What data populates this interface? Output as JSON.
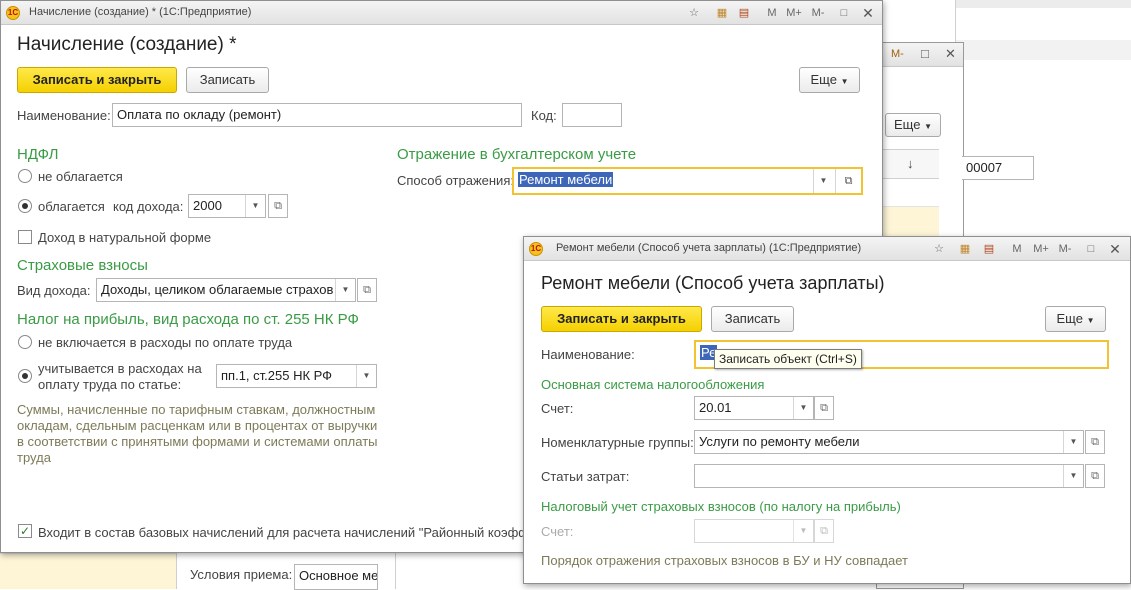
{
  "background_window": {
    "titlebar_buttons": [
      "M-",
      "□",
      "✕"
    ],
    "more_label": "Еще",
    "sort_arrow": "↓",
    "number_value": "00007",
    "conditions_label": "Условия приема:",
    "conditions_value": "Основное ме"
  },
  "main_window": {
    "title": "Начисление (создание) * (1С:Предприятие)",
    "titlebar_buttons": [
      "M",
      "M+",
      "M-",
      "□",
      "✕"
    ],
    "form_title": "Начисление (создание) *",
    "save_close_label": "Записать и закрыть",
    "save_label": "Записать",
    "more_label": "Еще",
    "name_label": "Наименование:",
    "name_value": "Оплата по окладу (ремонт)",
    "code_label": "Код:",
    "code_value": "",
    "ndfl": {
      "heading": "НДФЛ",
      "not_taxed_label": "не облагается",
      "taxed_label": "облагается",
      "income_code_label": "код дохода:",
      "income_code_value": "2000",
      "natural_income_label": "Доход в натуральной форме"
    },
    "accounting": {
      "heading": "Отражение в бухгалтерском учете",
      "method_label": "Способ отражения:",
      "method_value": "Ремонт мебели"
    },
    "insurance": {
      "heading": "Страховые взносы",
      "income_type_label": "Вид дохода:",
      "income_type_value": "Доходы, целиком облагаемые страхов"
    },
    "profit_tax": {
      "heading": "Налог на прибыль, вид расхода по ст. 255 НК РФ",
      "not_included_label": "не включается в расходы по оплате труда",
      "included_label_line1": "учитывается в расходах на",
      "included_label_line2": "оплату труда по статье:",
      "article_value": "пп.1, ст.255 НК РФ",
      "note": "Суммы, начисленные по тарифным ставкам, должностным окладам, сдельным расценкам или в процентах от выручки в соответствии с принятыми формами и системами оплаты труда"
    },
    "base_accruals_label": "Входит в состав базовых начислений для расчета начислений \"Районный коэфф"
  },
  "dialog": {
    "title": "Ремонт мебели (Способ учета зарплаты) (1С:Предприятие)",
    "titlebar_buttons": [
      "M",
      "M+",
      "M-",
      "□",
      "✕"
    ],
    "form_title": "Ремонт мебели (Способ учета зарплаты)",
    "save_close_label": "Записать и закрыть",
    "save_label": "Записать",
    "more_label": "Еще",
    "name_label": "Наименование:",
    "name_value_selected": "Ре",
    "tooltip": "Записать объект (Ctrl+S)",
    "main_tax_heading": "Основная система налогообложения",
    "account_label": "Счет:",
    "account_value": "20.01",
    "nomenclature_label": "Номенклатурные группы:",
    "nomenclature_value": "Услуги по ремонту мебели",
    "cost_items_label": "Статьи затрат:",
    "cost_items_value": "",
    "insurance_tax_heading": "Налоговый учет страховых взносов (по налогу на прибыль)",
    "insurance_account_label": "Счет:",
    "insurance_account_value": "",
    "note": "Порядок отражения страховых взносов в БУ и НУ совпадает"
  }
}
